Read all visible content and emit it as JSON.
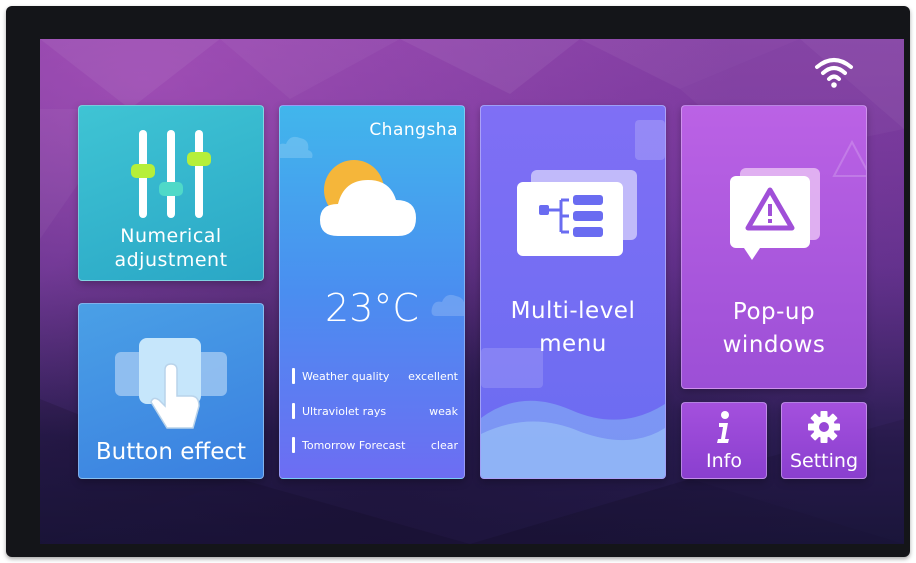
{
  "tiles": {
    "numerical": {
      "label_line1": "Numerical",
      "label_line2": "adjustment"
    },
    "button_effect": {
      "label": "Button effect"
    },
    "weather": {
      "city": "Changsha",
      "temperature": "23°C",
      "rows": [
        {
          "key": "Weather quality",
          "value": "excellent"
        },
        {
          "key": "Ultraviolet rays",
          "value": "weak"
        },
        {
          "key": "Tomorrow Forecast",
          "value": "clear"
        }
      ]
    },
    "menu": {
      "label_line1": "Multi-level",
      "label_line2": "menu"
    },
    "popup": {
      "label_line1": "Pop-up",
      "label_line2": "windows"
    },
    "info": {
      "label": "Info"
    },
    "setting": {
      "label": "Setting"
    }
  },
  "status": {
    "wifi_icon": "wifi-icon"
  },
  "colors": {
    "numerical_tile": "#35b8cd",
    "button_tile": "#438fe4",
    "weather_tile": "#4a9aef",
    "menu_tile": "#7670f3",
    "popup_tile": "#b05bdf",
    "small_tiles": "#9747d6",
    "slider_accent": "#b6ef3a"
  }
}
